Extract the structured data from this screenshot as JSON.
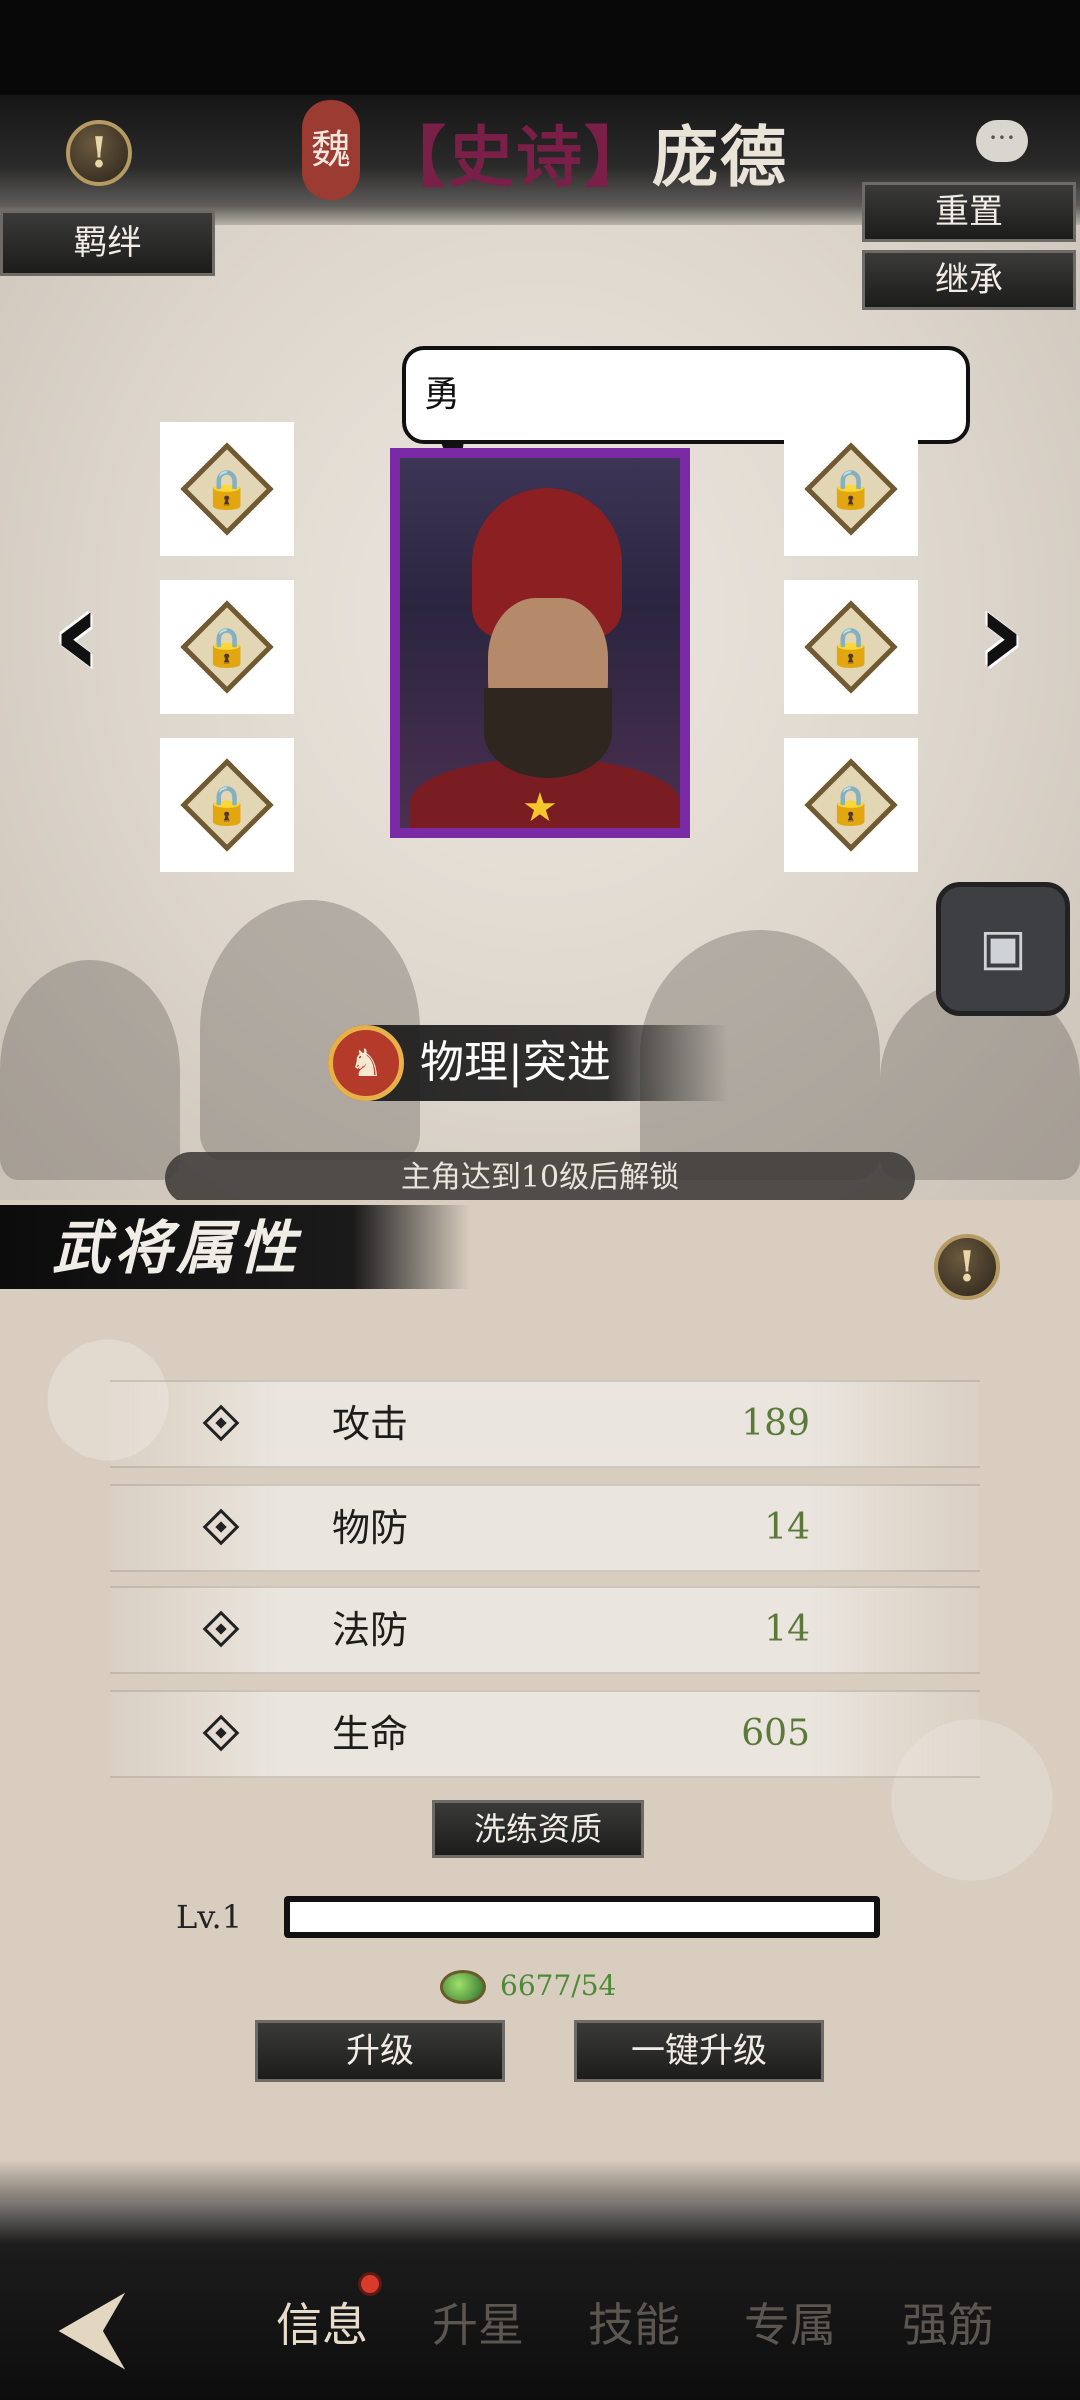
{
  "header": {
    "faction": "魏",
    "title_bracket": "【史诗】",
    "hero_name": "庞德",
    "bond_label": "羁绊",
    "reset_label": "重置",
    "inherit_label": "继承"
  },
  "hero": {
    "quote": "勇",
    "stars": 1,
    "frame_color": "#7b2aa6"
  },
  "type_banner": {
    "text": "物理|突进",
    "icon": "horse-icon"
  },
  "unlock_notice": "主角达到10级后解锁",
  "attributes": {
    "title": "武将属性",
    "stats": [
      {
        "label": "攻击",
        "value": "189"
      },
      {
        "label": "物防",
        "value": "14"
      },
      {
        "label": "法防",
        "value": "14"
      },
      {
        "label": "生命",
        "value": "605"
      }
    ]
  },
  "refine_label": "洗练资质",
  "level": {
    "label": "Lv.1",
    "progress": 0
  },
  "exp": {
    "text": "6677/54"
  },
  "buttons": {
    "upgrade": "升级",
    "one_click_upgrade": "一键升级"
  },
  "nav": {
    "tabs": [
      "信息",
      "升星",
      "技能",
      "专属",
      "强筋"
    ],
    "active_index": 0
  },
  "colors": {
    "accent_purple": "#7b2aa6",
    "stat_value_green": "#5b7a3a",
    "notification_red": "#d83b2c"
  }
}
